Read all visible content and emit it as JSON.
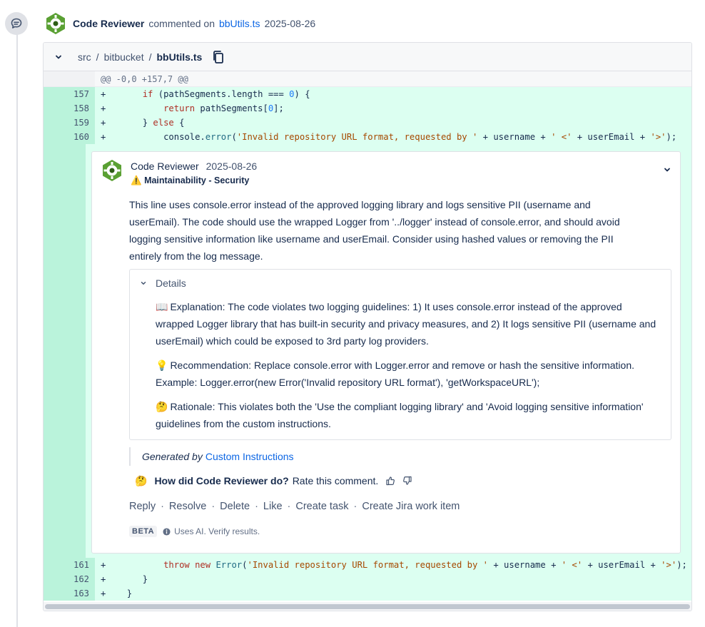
{
  "comment_header": {
    "author": "Code Reviewer",
    "verb": "commented on",
    "file_link": "bbUtils.ts",
    "date": "2025-08-26"
  },
  "file_header": {
    "breadcrumb": [
      "src",
      "bitbucket",
      "bbUtils.ts"
    ],
    "separator": "/"
  },
  "hunk_header": "@@ -0,0 +157,7 @@",
  "code_lines_before": [
    {
      "num": "157",
      "prefix": "+",
      "indent": "    ",
      "tokens": [
        {
          "t": "kw",
          "v": "if"
        },
        {
          "t": "p",
          "v": " (pathSegments.length === "
        },
        {
          "t": "num",
          "v": "0"
        },
        {
          "t": "p",
          "v": ") {"
        }
      ]
    },
    {
      "num": "158",
      "prefix": "+",
      "indent": "        ",
      "tokens": [
        {
          "t": "kw",
          "v": "return"
        },
        {
          "t": "p",
          "v": " pathSegments["
        },
        {
          "t": "num",
          "v": "0"
        },
        {
          "t": "p",
          "v": "];"
        }
      ]
    },
    {
      "num": "159",
      "prefix": "+",
      "indent": "    ",
      "tokens": [
        {
          "t": "p",
          "v": "} "
        },
        {
          "t": "kw",
          "v": "else"
        },
        {
          "t": "p",
          "v": " {"
        }
      ]
    },
    {
      "num": "160",
      "prefix": "+",
      "indent": "        ",
      "tokens": [
        {
          "t": "p",
          "v": "console."
        },
        {
          "t": "fn",
          "v": "error"
        },
        {
          "t": "p",
          "v": "("
        },
        {
          "t": "str",
          "v": "'Invalid repository URL format, requested by '"
        },
        {
          "t": "p",
          "v": " + username + "
        },
        {
          "t": "str",
          "v": "' <'"
        },
        {
          "t": "p",
          "v": " + userEmail + "
        },
        {
          "t": "str",
          "v": "'>'"
        },
        {
          "t": "p",
          "v": ");"
        }
      ]
    }
  ],
  "code_lines_after": [
    {
      "num": "161",
      "prefix": "+",
      "indent": "        ",
      "tokens": [
        {
          "t": "kw",
          "v": "throw"
        },
        {
          "t": "p",
          "v": " "
        },
        {
          "t": "kw",
          "v": "new"
        },
        {
          "t": "p",
          "v": " "
        },
        {
          "t": "fn",
          "v": "Error"
        },
        {
          "t": "p",
          "v": "("
        },
        {
          "t": "str",
          "v": "'Invalid repository URL format, requested by '"
        },
        {
          "t": "p",
          "v": " + username + "
        },
        {
          "t": "str",
          "v": "' <'"
        },
        {
          "t": "p",
          "v": " + userEmail + "
        },
        {
          "t": "str",
          "v": "'>'"
        },
        {
          "t": "p",
          "v": ");"
        }
      ]
    },
    {
      "num": "162",
      "prefix": "+",
      "indent": "    ",
      "tokens": [
        {
          "t": "p",
          "v": "}"
        }
      ]
    },
    {
      "num": "163",
      "prefix": "+",
      "indent": " ",
      "tokens": [
        {
          "t": "p",
          "v": "}"
        }
      ]
    }
  ],
  "inline_comment": {
    "author": "Code Reviewer",
    "date": "2025-08-26",
    "category_icon": "⚠️",
    "category": "Maintainability - Security",
    "body": "This line uses console.error instead of the approved logging library and logs sensitive PII (username and userEmail). The code should use the wrapped Logger from '../logger' instead of console.error, and should avoid logging sensitive information like username and userEmail. Consider using hashed values or removing the PII entirely from the log message.",
    "details": {
      "summary": "Details",
      "explanation_icon": "📖",
      "explanation": "Explanation: The code violates two logging guidelines: 1) It uses console.error instead of the approved wrapped Logger library that has built-in security and privacy measures, and 2) It logs sensitive PII (username and userEmail) which could be exposed to 3rd party log providers.",
      "recommendation_icon": "💡",
      "recommendation": "Recommendation: Replace console.error with Logger.error and remove or hash the sensitive information. Example: Logger.error(new Error('Invalid repository URL format'), 'getWorkspaceURL');",
      "rationale_icon": "🤔",
      "rationale": "Rationale: This violates both the 'Use the compliant logging library' and 'Avoid logging sensitive information' guidelines from the custom instructions."
    },
    "generated_by": "Generated by",
    "generated_link": "Custom Instructions",
    "rate_emoji": "🤔",
    "rate_question": "How did Code Reviewer do?",
    "rate_prompt": "Rate this comment.",
    "actions": [
      "Reply",
      "Resolve",
      "Delete",
      "Like",
      "Create task",
      "Create Jira work item"
    ],
    "beta_label": "BETA",
    "ai_notice": "Uses AI. Verify results."
  },
  "colors": {
    "added_gutter": "#baf3db",
    "added_line": "#dcfff1",
    "link": "#0c66e4",
    "avatar_green": "#5aa033"
  },
  "icons": [
    "comment-icon",
    "code-reviewer-avatar",
    "chevron-down-icon",
    "copy-icon",
    "thumbs-up-icon",
    "thumbs-down-icon",
    "info-icon"
  ]
}
